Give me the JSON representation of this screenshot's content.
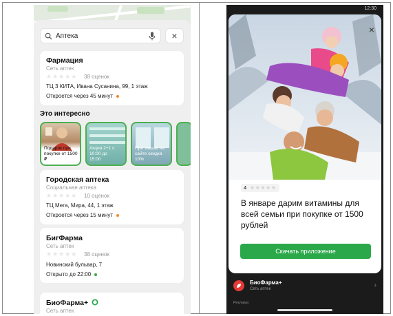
{
  "left": {
    "search": {
      "value": "Аптека",
      "close": "×"
    },
    "pharmacies": [
      {
        "name": "Фармация",
        "type": "Сеть аптек",
        "stars": "★★★★★",
        "reviews": "38 оценок",
        "address": "ТЦ 3 КИТА, Ивана Сусанина, 99, 1 этаж",
        "hours": "Откроется через 45 минут",
        "dot_color": "#f28c28"
      },
      {
        "name": "Городская аптека",
        "type": "Социальная аптека",
        "stars": "★★★★★",
        "reviews": "10 оценок",
        "address": "ТЦ Мега, Мира, 44, 1 этаж",
        "hours": "Откроется через 15 минут",
        "dot_color": "#f28c28"
      },
      {
        "name": "БигФарма",
        "type": "Сеть аптек",
        "stars": "★★★★★",
        "reviews": "38 оценок",
        "address": "Новинский бульвар, 7",
        "hours": "Открыто до 22:00",
        "dot_color": "#3aa845"
      },
      {
        "name": "БиоФарма+",
        "type": "Сеть аптек"
      }
    ],
    "section_title": "Это интересно",
    "promos": [
      {
        "text": "Подарок при покупке от 1500 ₽"
      },
      {
        "text": "Акция 2+1 с 10:00 до 15:00"
      },
      {
        "text": "При заказе на сайте скидка 10%"
      }
    ]
  },
  "right": {
    "status_time": "12:30",
    "ad": {
      "close": "×",
      "rating_value": "4",
      "rating_stars": "★★★★★",
      "headline": "В январе дарим витамины для всей семьи при покупке от 1500 рублей",
      "button": "Скачать приложение"
    },
    "advertiser": {
      "name": "БиоФарма+",
      "type": "Сеть аптек",
      "ad_label": "Реклама",
      "chevron": "›"
    }
  },
  "colors": {
    "accent_green": "#2aa84a",
    "promo_border": "#4caf50",
    "dark_bg": "#1b1b1b"
  }
}
